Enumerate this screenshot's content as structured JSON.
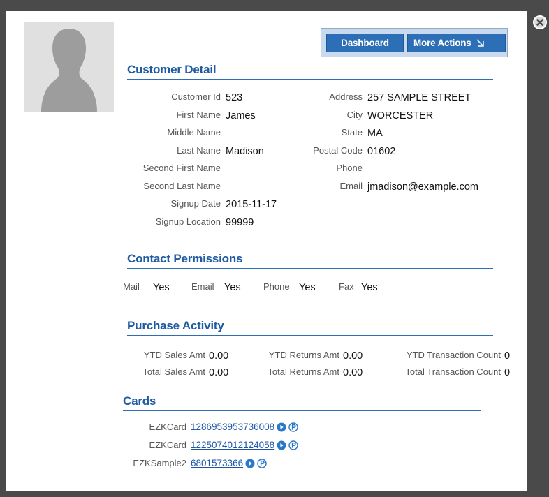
{
  "buttons": {
    "dashboard": "Dashboard",
    "more_actions": "More Actions"
  },
  "sections": {
    "customer_detail": "Customer Detail",
    "contact_permissions": "Contact Permissions",
    "purchase_activity": "Purchase Activity",
    "cards": "Cards"
  },
  "customer_left": [
    {
      "label": "Customer Id",
      "value": "523"
    },
    {
      "label": "First Name",
      "value": "James"
    },
    {
      "label": "Middle Name",
      "value": ""
    },
    {
      "label": "Last Name",
      "value": "Madison"
    },
    {
      "label": "Second First Name",
      "value": ""
    },
    {
      "label": "Second Last Name",
      "value": ""
    },
    {
      "label": "Signup Date",
      "value": "2015-11-17"
    },
    {
      "label": "Signup Location",
      "value": "99999"
    }
  ],
  "customer_right": [
    {
      "label": "Address",
      "value": "257 SAMPLE STREET"
    },
    {
      "label": "City",
      "value": "WORCESTER"
    },
    {
      "label": "State",
      "value": "MA"
    },
    {
      "label": "Postal Code",
      "value": "01602"
    },
    {
      "label": "Phone",
      "value": ""
    },
    {
      "label": "Email",
      "value": "jmadison@example.com"
    }
  ],
  "permissions": [
    {
      "label": "Mail",
      "value": "Yes"
    },
    {
      "label": "Email",
      "value": "Yes"
    },
    {
      "label": "Phone",
      "value": "Yes"
    },
    {
      "label": "Fax",
      "value": "Yes"
    }
  ],
  "purchase": [
    [
      {
        "label": "YTD Sales Amt",
        "value": "0.00"
      },
      {
        "label": "YTD Returns Amt",
        "value": "0.00"
      },
      {
        "label": "YTD Transaction Count",
        "value": "0"
      }
    ],
    [
      {
        "label": "Total Sales Amt",
        "value": "0.00"
      },
      {
        "label": "Total Returns Amt",
        "value": "0.00"
      },
      {
        "label": "Total Transaction Count",
        "value": "0"
      }
    ]
  ],
  "cards": [
    {
      "type": "EZKCard",
      "number": "1286953953736008"
    },
    {
      "type": "EZKCard",
      "number": "1225074012124058"
    },
    {
      "type": "EZKSample2",
      "number": "6801573366"
    }
  ],
  "colors": {
    "accent": "#1f5aa3",
    "button": "#2d6fb6",
    "button_bar": "#c9d9ee",
    "overlay": "#4a4a4a"
  },
  "icons": {
    "close": "close-circle-icon",
    "more_actions": "arrow-down-right-icon",
    "card_go": "play-circle-icon",
    "card_points": "p-circle-icon",
    "avatar": "person-silhouette-icon"
  }
}
